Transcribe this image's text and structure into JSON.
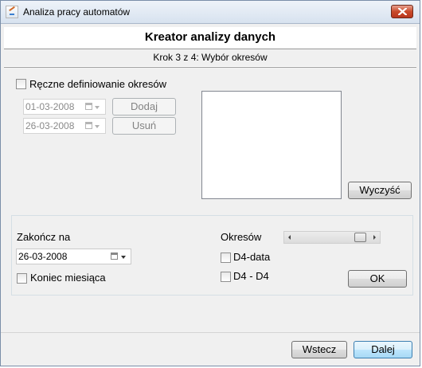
{
  "window": {
    "title": "Analiza pracy automatów"
  },
  "wizard": {
    "title": "Kreator analizy danych",
    "step": "Krok 3 z 4: Wybór okresów"
  },
  "manual": {
    "checkbox_label": "Ręczne definiowanie okresów",
    "checked": false,
    "date_from": "01-03-2008",
    "date_to": "26-03-2008",
    "add_label": "Dodaj",
    "remove_label": "Usuń",
    "clear_label": "Wyczyść",
    "periods_list": []
  },
  "auto": {
    "end_label": "Zakończ na",
    "end_date": "26-03-2008",
    "month_end_label": "Koniec miesiąca",
    "month_end_checked": false,
    "periods_label": "Okresów",
    "d4_data_label": "D4-data",
    "d4_d4_label": "D4 - D4",
    "ok_label": "OK"
  },
  "footer": {
    "back_label": "Wstecz",
    "next_label": "Dalej"
  }
}
